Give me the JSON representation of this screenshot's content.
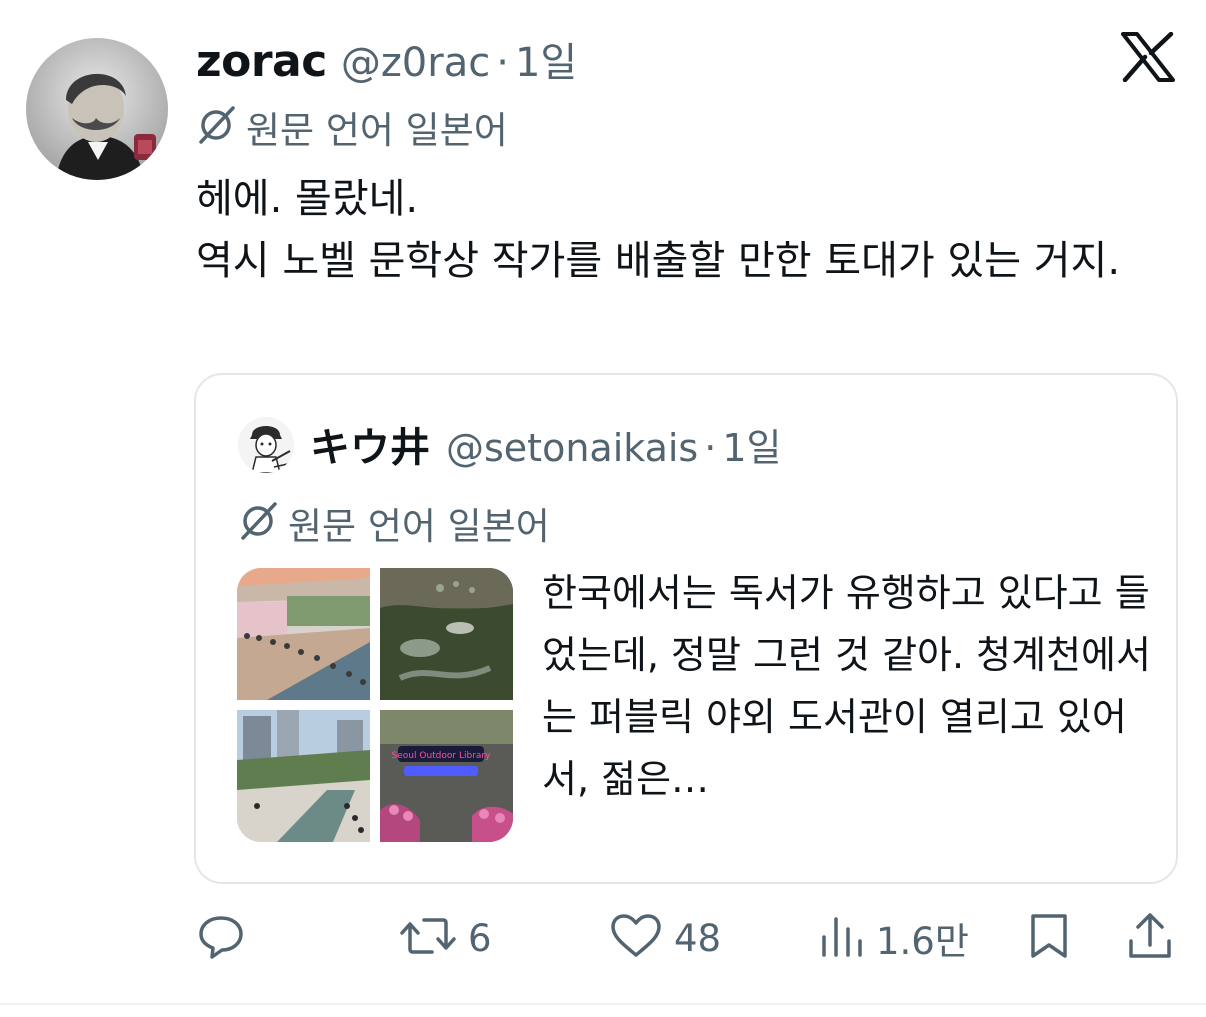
{
  "tweet": {
    "display_name": "zorac",
    "handle": "@z0rac",
    "separator": "·",
    "time": "1일",
    "translation_label": "원문 언어 일본어",
    "text": "헤에. 몰랐네.\n역시 노벨 문학상 작가를 배출할 만한 토대가 있는 거지."
  },
  "quoted": {
    "display_name": "キウ井",
    "handle": "@setonaikais",
    "separator": "·",
    "time": "1일",
    "translation_label": "원문 언어 일본어",
    "text": "한국에서는 독서가 유행하고 있다고 들었는데, 정말 그런 것 같아. 청계천에서는 퍼블릭 야외 도서관이 열리고 있어서, 젊은…",
    "media_sign_text": "Seoul Outdoor Library"
  },
  "actions": {
    "reply_count": "",
    "retweet_count": "6",
    "like_count": "48",
    "views_count": "1.6만"
  },
  "icons": {
    "brand": "x-logo-icon",
    "translate": "globe-slash-icon",
    "reply": "reply-icon",
    "retweet": "retweet-icon",
    "like": "heart-icon",
    "views": "views-icon",
    "bookmark": "bookmark-icon",
    "share": "share-icon"
  },
  "colors": {
    "text_primary": "#0f1419",
    "text_secondary": "#536471",
    "border": "#e3e7ea"
  }
}
